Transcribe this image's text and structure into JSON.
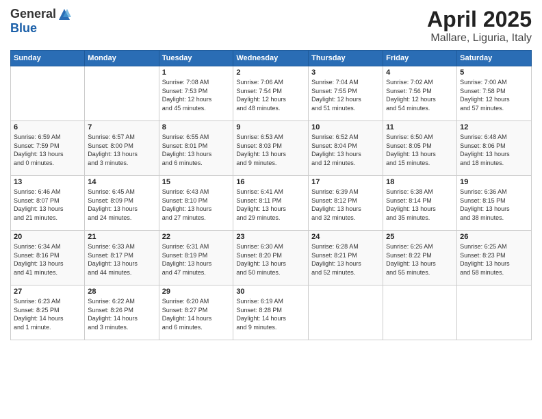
{
  "header": {
    "logo_general": "General",
    "logo_blue": "Blue",
    "title": "April 2025",
    "location": "Mallare, Liguria, Italy"
  },
  "calendar": {
    "days_of_week": [
      "Sunday",
      "Monday",
      "Tuesday",
      "Wednesday",
      "Thursday",
      "Friday",
      "Saturday"
    ],
    "weeks": [
      [
        {
          "day": "",
          "info": ""
        },
        {
          "day": "",
          "info": ""
        },
        {
          "day": "1",
          "info": "Sunrise: 7:08 AM\nSunset: 7:53 PM\nDaylight: 12 hours\nand 45 minutes."
        },
        {
          "day": "2",
          "info": "Sunrise: 7:06 AM\nSunset: 7:54 PM\nDaylight: 12 hours\nand 48 minutes."
        },
        {
          "day": "3",
          "info": "Sunrise: 7:04 AM\nSunset: 7:55 PM\nDaylight: 12 hours\nand 51 minutes."
        },
        {
          "day": "4",
          "info": "Sunrise: 7:02 AM\nSunset: 7:56 PM\nDaylight: 12 hours\nand 54 minutes."
        },
        {
          "day": "5",
          "info": "Sunrise: 7:00 AM\nSunset: 7:58 PM\nDaylight: 12 hours\nand 57 minutes."
        }
      ],
      [
        {
          "day": "6",
          "info": "Sunrise: 6:59 AM\nSunset: 7:59 PM\nDaylight: 13 hours\nand 0 minutes."
        },
        {
          "day": "7",
          "info": "Sunrise: 6:57 AM\nSunset: 8:00 PM\nDaylight: 13 hours\nand 3 minutes."
        },
        {
          "day": "8",
          "info": "Sunrise: 6:55 AM\nSunset: 8:01 PM\nDaylight: 13 hours\nand 6 minutes."
        },
        {
          "day": "9",
          "info": "Sunrise: 6:53 AM\nSunset: 8:03 PM\nDaylight: 13 hours\nand 9 minutes."
        },
        {
          "day": "10",
          "info": "Sunrise: 6:52 AM\nSunset: 8:04 PM\nDaylight: 13 hours\nand 12 minutes."
        },
        {
          "day": "11",
          "info": "Sunrise: 6:50 AM\nSunset: 8:05 PM\nDaylight: 13 hours\nand 15 minutes."
        },
        {
          "day": "12",
          "info": "Sunrise: 6:48 AM\nSunset: 8:06 PM\nDaylight: 13 hours\nand 18 minutes."
        }
      ],
      [
        {
          "day": "13",
          "info": "Sunrise: 6:46 AM\nSunset: 8:07 PM\nDaylight: 13 hours\nand 21 minutes."
        },
        {
          "day": "14",
          "info": "Sunrise: 6:45 AM\nSunset: 8:09 PM\nDaylight: 13 hours\nand 24 minutes."
        },
        {
          "day": "15",
          "info": "Sunrise: 6:43 AM\nSunset: 8:10 PM\nDaylight: 13 hours\nand 27 minutes."
        },
        {
          "day": "16",
          "info": "Sunrise: 6:41 AM\nSunset: 8:11 PM\nDaylight: 13 hours\nand 29 minutes."
        },
        {
          "day": "17",
          "info": "Sunrise: 6:39 AM\nSunset: 8:12 PM\nDaylight: 13 hours\nand 32 minutes."
        },
        {
          "day": "18",
          "info": "Sunrise: 6:38 AM\nSunset: 8:14 PM\nDaylight: 13 hours\nand 35 minutes."
        },
        {
          "day": "19",
          "info": "Sunrise: 6:36 AM\nSunset: 8:15 PM\nDaylight: 13 hours\nand 38 minutes."
        }
      ],
      [
        {
          "day": "20",
          "info": "Sunrise: 6:34 AM\nSunset: 8:16 PM\nDaylight: 13 hours\nand 41 minutes."
        },
        {
          "day": "21",
          "info": "Sunrise: 6:33 AM\nSunset: 8:17 PM\nDaylight: 13 hours\nand 44 minutes."
        },
        {
          "day": "22",
          "info": "Sunrise: 6:31 AM\nSunset: 8:19 PM\nDaylight: 13 hours\nand 47 minutes."
        },
        {
          "day": "23",
          "info": "Sunrise: 6:30 AM\nSunset: 8:20 PM\nDaylight: 13 hours\nand 50 minutes."
        },
        {
          "day": "24",
          "info": "Sunrise: 6:28 AM\nSunset: 8:21 PM\nDaylight: 13 hours\nand 52 minutes."
        },
        {
          "day": "25",
          "info": "Sunrise: 6:26 AM\nSunset: 8:22 PM\nDaylight: 13 hours\nand 55 minutes."
        },
        {
          "day": "26",
          "info": "Sunrise: 6:25 AM\nSunset: 8:23 PM\nDaylight: 13 hours\nand 58 minutes."
        }
      ],
      [
        {
          "day": "27",
          "info": "Sunrise: 6:23 AM\nSunset: 8:25 PM\nDaylight: 14 hours\nand 1 minute."
        },
        {
          "day": "28",
          "info": "Sunrise: 6:22 AM\nSunset: 8:26 PM\nDaylight: 14 hours\nand 3 minutes."
        },
        {
          "day": "29",
          "info": "Sunrise: 6:20 AM\nSunset: 8:27 PM\nDaylight: 14 hours\nand 6 minutes."
        },
        {
          "day": "30",
          "info": "Sunrise: 6:19 AM\nSunset: 8:28 PM\nDaylight: 14 hours\nand 9 minutes."
        },
        {
          "day": "",
          "info": ""
        },
        {
          "day": "",
          "info": ""
        },
        {
          "day": "",
          "info": ""
        }
      ]
    ]
  }
}
